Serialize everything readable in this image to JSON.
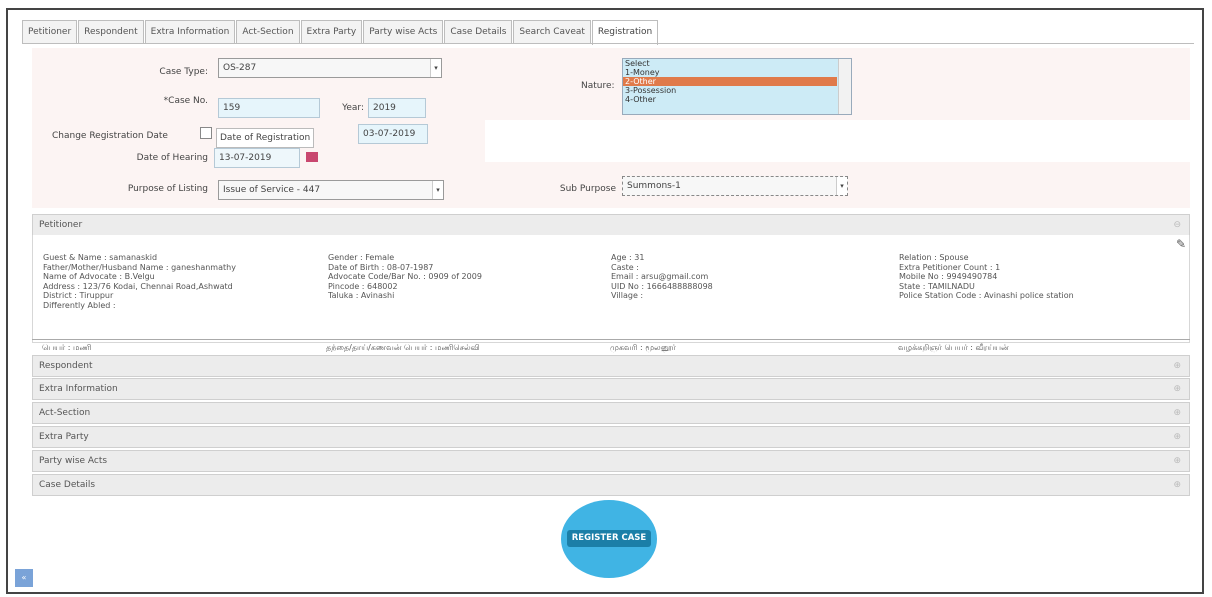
{
  "tabs": [
    "Petitioner",
    "Respondent",
    "Extra Information",
    "Act-Section",
    "Extra Party",
    "Party wise Acts",
    "Case Details",
    "Search Caveat",
    "Registration"
  ],
  "active_tab": "Registration",
  "form": {
    "case_type_label": "Case Type:",
    "case_type_value": "OS-287",
    "case_no_label": "*Case No.",
    "case_no_value": "159",
    "year_label": "Year:",
    "year_value": "2019",
    "change_reg_date_label": "Change Registration Date",
    "date_of_registration_label": "Date of Registration",
    "date_of_registration_value": "03-07-2019",
    "date_of_hearing_label": "Date of Hearing",
    "date_of_hearing_value": "13-07-2019",
    "purpose_label": "Purpose of Listing",
    "purpose_value": "Issue of Service - 447",
    "nature_label": "Nature:",
    "nature_options": [
      "Select",
      "1-Money",
      "2-Other",
      "3-Possession",
      "4-Other"
    ],
    "nature_selected_index": 2,
    "sub_purpose_label": "Sub Purpose",
    "sub_purpose_value": "Summons-1"
  },
  "petitioner": {
    "header": "Petitioner",
    "col1": [
      "Guest & Name : samanaskid",
      "Father/Mother/Husband Name : ganeshanmathy",
      "Name of Advocate : B.Velgu",
      "Address : 123/76 Kodai, Chennai Road,Ashwatd",
      "District : Tiruppur",
      "Differently Abled :"
    ],
    "col2": [
      "Gender : Female",
      "Date of Birth : 08-07-1987",
      "Advocate Code/Bar No. : 0909 of 2009",
      "Pincode : 648002",
      "Taluka : Avinashi"
    ],
    "col3": [
      "Age : 31",
      "Caste :",
      "Email : arsu@gmail.com",
      "UID No : 1666488888098",
      "Village :"
    ],
    "col4": [
      "Relation : Spouse",
      "Extra Petitioner Count : 1",
      "Mobile No : 9949490784",
      "State : TAMILNADU",
      "Police Station Code : Avinashi police station"
    ],
    "regional": [
      "பெயர் : மணி",
      "தந்தை/தாய்/கணவன் பெயர் : மணிசெல்வி",
      "முகவரி : மூலனூர்",
      "வழக்கறிஞர் பெயர் : வீரய்யன்"
    ]
  },
  "accordion": [
    "Respondent",
    "Extra Information",
    "Act-Section",
    "Extra Party",
    "Party wise Acts",
    "Case Details"
  ],
  "register_button": "REGISTER CASE",
  "corner_icon": "dbl-arrow-icon"
}
